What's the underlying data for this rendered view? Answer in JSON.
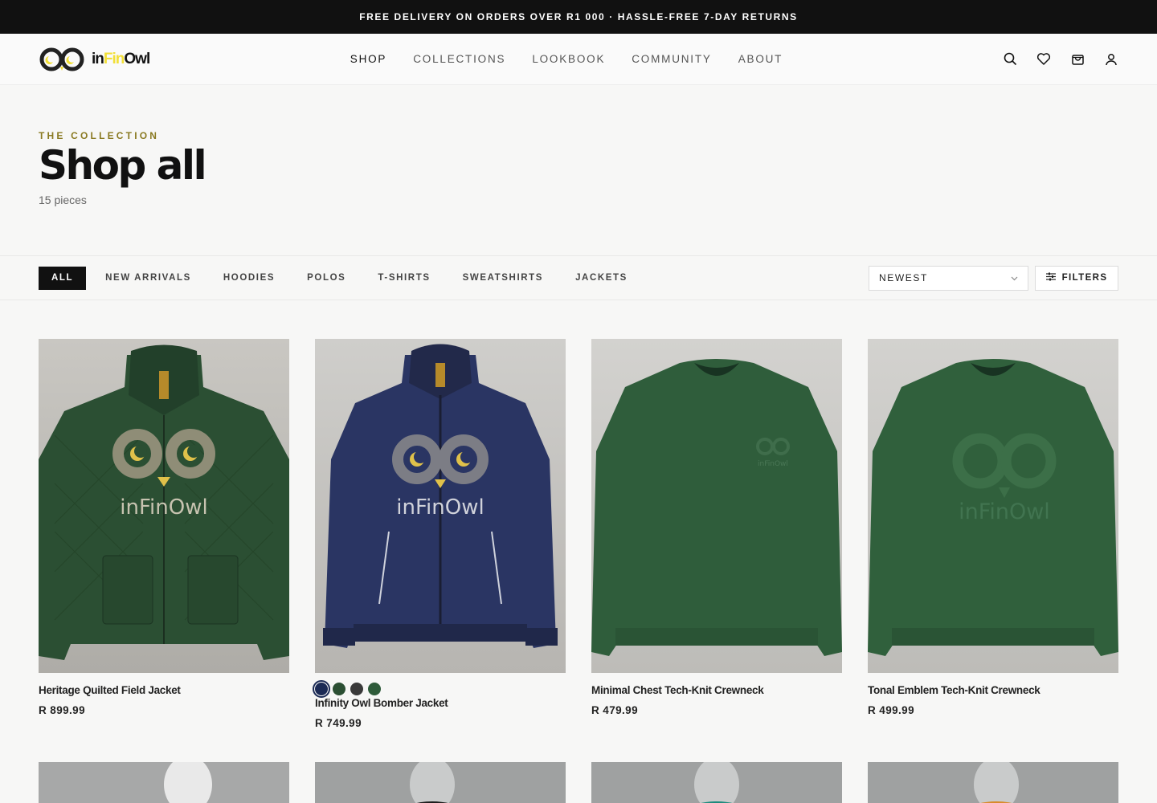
{
  "announcement": "FREE DELIVERY ON ORDERS OVER R1 000 · HASSLE-FREE 7-DAY RETURNS",
  "brand": {
    "prefix": "in",
    "highlight": "Fin",
    "suffix": "Owl"
  },
  "nav": [
    "SHOP",
    "COLLECTIONS",
    "LOOKBOOK",
    "COMMUNITY",
    "ABOUT"
  ],
  "hero": {
    "eyebrow": "THE COLLECTION",
    "title": "Shop all",
    "count": "15 pieces"
  },
  "categories": [
    "ALL",
    "NEW ARRIVALS",
    "HOODIES",
    "POLOS",
    "T-SHIRTS",
    "SWEATSHIRTS",
    "JACKETS"
  ],
  "sort": {
    "value": "NEWEST"
  },
  "filters_label": "FILTERS",
  "products": [
    {
      "name": "Heritage Quilted Field Jacket",
      "price": "R 899.99",
      "color": "#2b4f33",
      "print_text": "inFinOwl"
    },
    {
      "name": "Infinity Owl Bomber Jacket",
      "price": "R 749.99",
      "color": "#2a3563",
      "print_text": "inFinOwl",
      "swatches": [
        "#1b2a55",
        "#2b4f33",
        "#3a3a3a",
        "#2e5b3a"
      ]
    },
    {
      "name": "Minimal Chest Tech-Knit Crewneck",
      "price": "R 479.99",
      "color": "#2f5d3b",
      "print_text": "inFinOwl"
    },
    {
      "name": "Tonal Emblem Tech-Knit Crewneck",
      "price": "R 499.99",
      "color": "#30603c",
      "print_text": "inFinOwl"
    }
  ],
  "colors": {
    "accent": "#f2df36",
    "eyebrow": "#8a7a22",
    "dark": "#111111"
  }
}
